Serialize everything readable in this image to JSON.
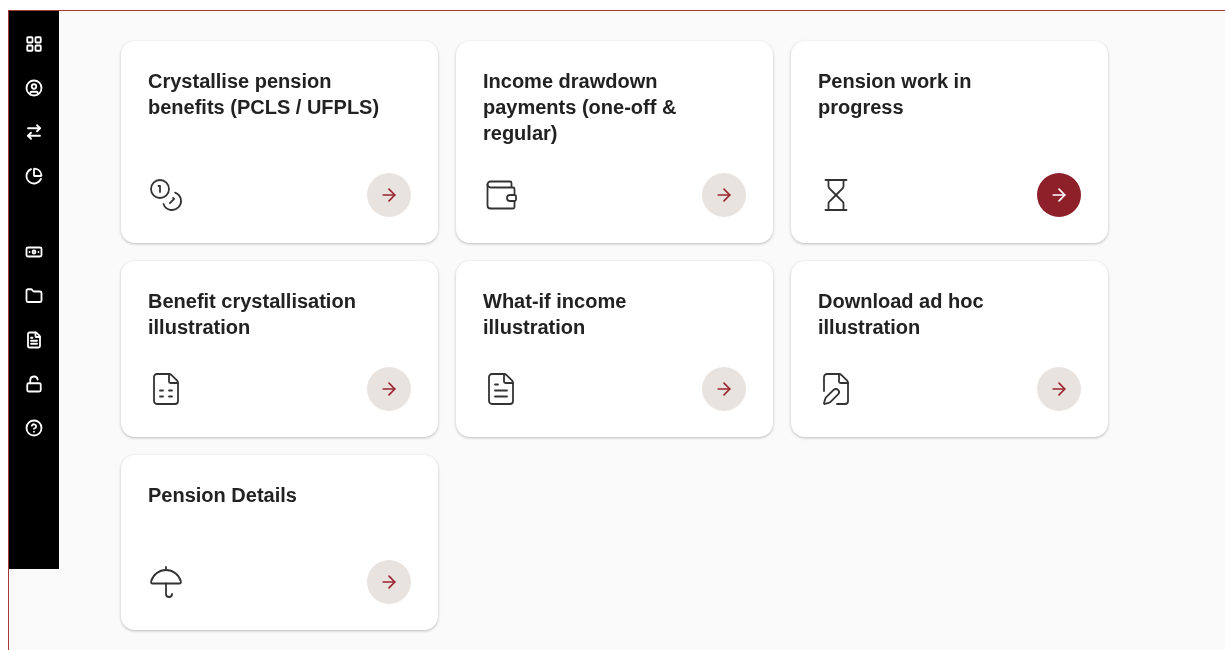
{
  "cards": [
    {
      "title": "Crystallise pension benefits (PCLS / UFPLS)",
      "selected": false
    },
    {
      "title": "Income drawdown payments (one-off & regular)",
      "selected": false
    },
    {
      "title": "Pension work in progress",
      "selected": true
    },
    {
      "title": "Benefit crystallisation illustration",
      "selected": false
    },
    {
      "title": "What-if income illustration",
      "selected": false
    },
    {
      "title": "Download ad hoc illustration",
      "selected": false
    },
    {
      "title": "Pension Details",
      "selected": false
    }
  ]
}
